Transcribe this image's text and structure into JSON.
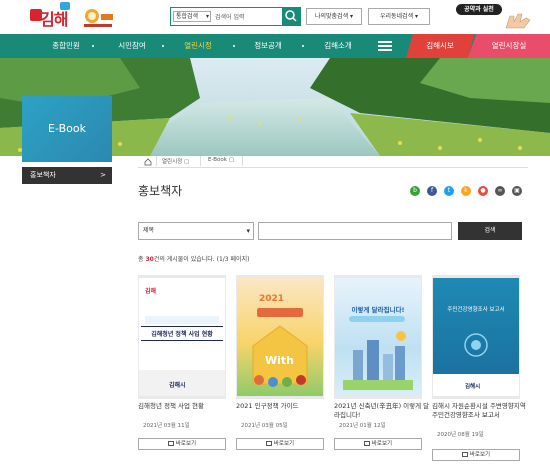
{
  "header": {
    "logo_text": "김해",
    "search_select": "통합검색",
    "search_placeholder": "검색어 입력",
    "dropdown1": "나의맞춤검색 ▾",
    "dropdown2": "우리동네검색 ▾",
    "slogan": "공약과 실천"
  },
  "nav": {
    "items": [
      {
        "label": "종합민원"
      },
      {
        "label": "시민참여"
      },
      {
        "label": "열린시정"
      },
      {
        "label": "정보공개"
      },
      {
        "label": "김해소개"
      }
    ],
    "active_index": 2,
    "red_tab": "김해시보",
    "pink_tab": "열린시장실"
  },
  "sidebar": {
    "section_title": "E-Book",
    "items": [
      {
        "label": "홍보책자",
        "arrow": ">"
      }
    ]
  },
  "breadcrumb": [
    "열린시정",
    "E-Book"
  ],
  "page": {
    "title": "홍보책자",
    "share_icons": [
      {
        "name": "blog-icon",
        "glyph": "b",
        "color": "#3aa13a"
      },
      {
        "name": "facebook-icon",
        "glyph": "f",
        "color": "#3b5998"
      },
      {
        "name": "twitter-icon",
        "glyph": "t",
        "color": "#1da1f2"
      },
      {
        "name": "kakaostory-icon",
        "glyph": "k",
        "color": "#f5a623"
      },
      {
        "name": "band-icon",
        "glyph": "●",
        "color": "#e74c3c"
      },
      {
        "name": "link-icon",
        "glyph": "∞",
        "color": "#555555"
      },
      {
        "name": "print-icon",
        "glyph": "▣",
        "color": "#555555"
      }
    ]
  },
  "search": {
    "select_value": "제목",
    "button": "검색"
  },
  "total": {
    "prefix": "총 ",
    "count": "30",
    "suffix": "건의 게시물이 있습니다. (1/3 페이지)"
  },
  "cards": [
    {
      "title": "김해청년 정책 사업 현황",
      "date": "2021년 03월 11일",
      "view": "바로보기",
      "cover_title": "김해청년 정책 사업 현황",
      "cover_footer": "김해시"
    },
    {
      "title": "2021 인구정책 가이드",
      "date": "2021년 03월 05일",
      "view": "바로보기",
      "cover_title": "2021"
    },
    {
      "title": "2021년 신축년(辛丑年) 이렇게 달라집니다!",
      "date": "2021년 01월 12일",
      "view": "바로보기",
      "cover_title": "이렇게 달라집니다!"
    },
    {
      "title": "김해시 자원순환시설 주변영향지역 주민건강영향조사 보고서",
      "date": "2020년 08월 19일",
      "view": "바로보기",
      "cover_title": "주민건강영향조사 보고서",
      "cover_footer": "김해시"
    }
  ]
}
